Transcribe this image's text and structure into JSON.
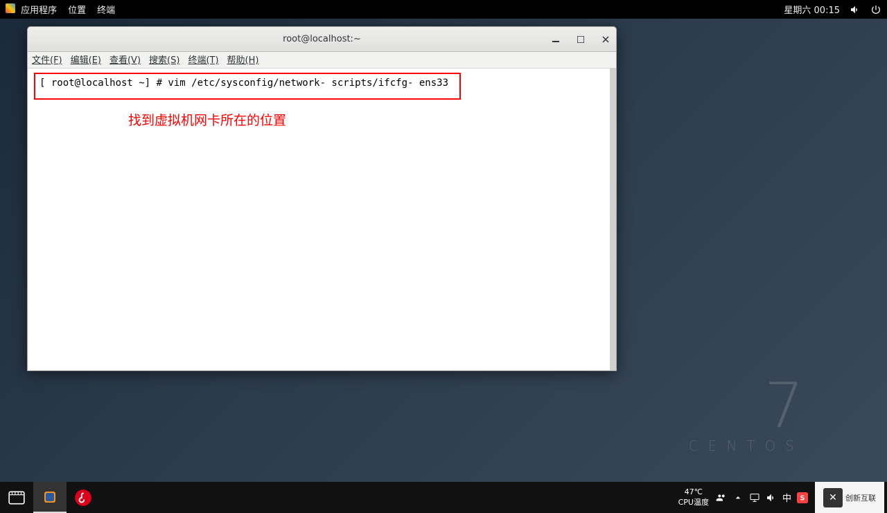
{
  "gnome_bar": {
    "apps": "应用程序",
    "places": "位置",
    "terminal": "终端",
    "datetime": "星期六 00:15"
  },
  "centos": {
    "version": "7",
    "name": "CENTOS"
  },
  "terminal": {
    "title": "root@localhost:~",
    "menu": {
      "file": "文件(F)",
      "edit": "编辑(E)",
      "view": "查看(V)",
      "search": "搜索(S)",
      "terminal": "终端(T)",
      "help": "帮助(H)"
    },
    "prompt_line": "[ root@localhost ~] #  vim /etc/sysconfig/network- scripts/ifcfg- ens33",
    "annotation": "找到虚拟机网卡所在的位置"
  },
  "taskbar": {
    "temp": "47℃",
    "temp_label": "CPU温度",
    "ime": "中"
  },
  "watermark": {
    "text": "创新互联"
  }
}
